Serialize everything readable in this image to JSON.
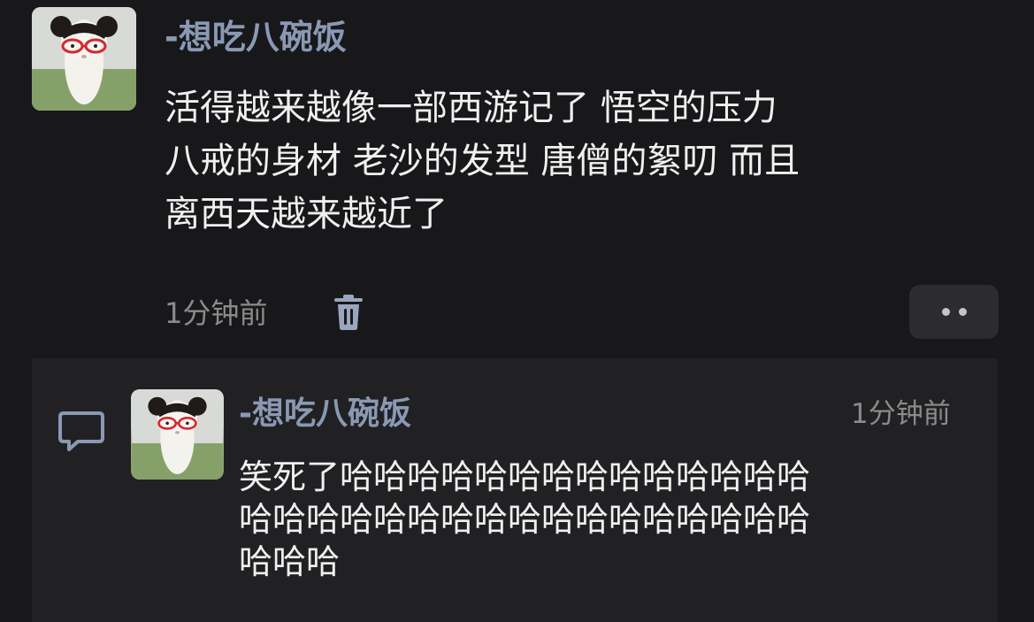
{
  "comment": {
    "username": "-想吃八碗饭",
    "lines": [
      "活得越来越像一部西游记了 悟空的压力",
      "八戒的身材 老沙的发型 唐僧的絮叨 而且",
      "离西天越来越近了"
    ],
    "time": "1分钟前",
    "delete_icon": "trash-icon",
    "more_icon": "more-dots-icon"
  },
  "reply": {
    "icon": "reply-bubble-icon",
    "username": "-想吃八碗饭",
    "time": "1分钟前",
    "lines": [
      "笑死了哈哈哈哈哈哈哈哈哈哈哈哈哈哈",
      "哈哈哈哈哈哈哈哈哈哈哈哈哈哈哈哈哈",
      "哈哈哈"
    ]
  },
  "colors": {
    "background": "#18181b",
    "reply_panel": "#212124",
    "username": "#8a99b3",
    "text": "#f0f0f0",
    "muted": "#8b8b8b"
  }
}
